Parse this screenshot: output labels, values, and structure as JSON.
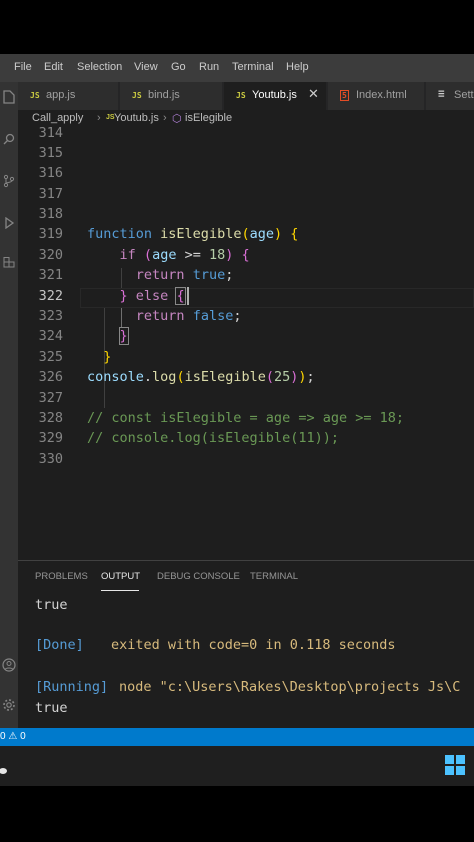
{
  "menu": [
    "File",
    "Edit",
    "Selection",
    "View",
    "Go",
    "Run",
    "Terminal",
    "Help"
  ],
  "tabs": [
    {
      "label": "app.js",
      "icon": "JS",
      "icon_color": "#cbcb41"
    },
    {
      "label": "bind.js",
      "icon": "JS",
      "icon_color": "#cbcb41"
    },
    {
      "label": "Youtub.js",
      "icon": "JS",
      "icon_color": "#cbcb41",
      "close": "✕"
    },
    {
      "label": "Index.html",
      "icon": "5",
      "icon_color": "#e44d26"
    },
    {
      "label": "Sett",
      "icon": "≡",
      "icon_color": "#cccccc"
    }
  ],
  "breadcrumb": {
    "folder": "Call_apply",
    "sep": "›",
    "file": "Youtub.js",
    "file_icon": "JS",
    "symbol": "isElegible",
    "symbol_icon": "⬡"
  },
  "editor": {
    "current_line": "322",
    "lines": [
      {
        "n": "314",
        "code": ""
      },
      {
        "n": "315",
        "code": ""
      },
      {
        "n": "316",
        "code": ""
      },
      {
        "n": "317",
        "code": ""
      },
      {
        "n": "318",
        "code": ""
      },
      {
        "n": "319",
        "code": "function isElegible(age) {"
      },
      {
        "n": "320",
        "code": "if (age >= 18) {"
      },
      {
        "n": "321",
        "code": "return true;"
      },
      {
        "n": "322",
        "code": "} else {"
      },
      {
        "n": "323",
        "code": "return false;"
      },
      {
        "n": "324",
        "code": "}"
      },
      {
        "n": "325",
        "code": "}"
      },
      {
        "n": "326",
        "code": "console.log(isElegible(25));"
      },
      {
        "n": "327",
        "code": ""
      },
      {
        "n": "328",
        "code": "// const isElegible = age => age >= 18;"
      },
      {
        "n": "329",
        "code": "// console.log(isElegible(11));"
      },
      {
        "n": "330",
        "code": ""
      }
    ]
  },
  "panel": {
    "tabs": [
      "PROBLEMS",
      "OUTPUT",
      "DEBUG CONSOLE",
      "TERMINAL"
    ],
    "active_tab": "OUTPUT",
    "output": {
      "line1": "true",
      "done_tag": "[Done]",
      "done_text": "exited with code=0 in 0.118 seconds",
      "running_tag": "[Running]",
      "running_cmd": "node \"c:\\Users\\Rakes\\Desktop\\projects Js\\C",
      "line_last": "true"
    }
  },
  "status": {
    "errors": "0",
    "warnings": "0"
  },
  "colors": {
    "accent": "#007acc",
    "keyword": "#569cd6",
    "function": "#dcdcaa",
    "variable": "#9cdcfe",
    "number": "#b5cea8",
    "comment": "#6a9955"
  }
}
